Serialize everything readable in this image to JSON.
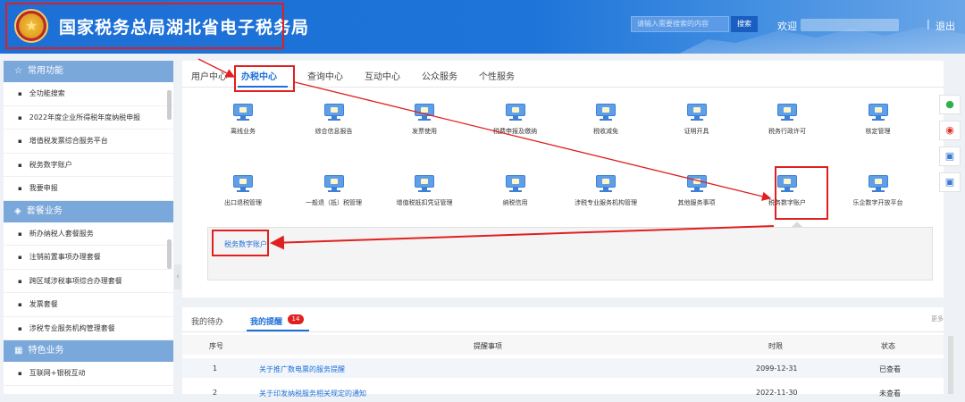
{
  "header": {
    "title": "国家税务总局湖北省电子税务局",
    "search_placeholder": "请输入需要搜索的内容",
    "search_button": "搜索",
    "welcome": "欢迎",
    "logout": "退出",
    "separator": "|"
  },
  "sidebar": {
    "categories": [
      {
        "icon": "star-icon",
        "label": "常用功能",
        "items": [
          "全功能搜索",
          "2022年度企业所得税年度纳税申报",
          "增值税发票综合服务平台",
          "税务数字账户",
          "我要申报"
        ]
      },
      {
        "icon": "layers-icon",
        "label": "套餐业务",
        "items": [
          "新办纳税人套餐服务",
          "注销前置事项办理套餐",
          "跨区域涉税事项综合办理套餐",
          "发票套餐",
          "涉税专业服务机构管理套餐"
        ]
      },
      {
        "icon": "grid-icon",
        "label": "特色业务",
        "items": [
          "互联网+银税互动"
        ]
      }
    ]
  },
  "tabs": [
    "用户中心",
    "办税中心",
    "查询中心",
    "互动中心",
    "公众服务",
    "个性服务"
  ],
  "active_tab": "办税中心",
  "tiles_row1": [
    "离线业务",
    "综合信息报告",
    "发票使用",
    "税费申报及缴纳",
    "税收减免",
    "证明开具",
    "税务行政许可",
    "核定管理"
  ],
  "tiles_row2": [
    "出口退税管理",
    "一般退（抵）税管理",
    "增值税抵扣凭证管理",
    "纳税信用",
    "涉税专业服务机构管理",
    "其他服务事项",
    "税务数字账户",
    "乐企数字开放平台"
  ],
  "sub_link": "税务数字账户",
  "bottom": {
    "tabs": [
      "我的待办",
      "我的提醒"
    ],
    "badge": "14",
    "more": "更多",
    "columns": [
      "序号",
      "提醒事项",
      "时限",
      "状态"
    ],
    "rows": [
      [
        "1",
        "关于推广数电票的服务提醒",
        "2099-12-31",
        "已查看"
      ],
      [
        "2",
        "关于印发纳税服务相关规定的通知",
        "2022-11-30",
        "未查看"
      ]
    ]
  },
  "colors": {
    "header": "#1c6fd6",
    "accent": "#1d6fd8",
    "highlight": "#e02020"
  }
}
